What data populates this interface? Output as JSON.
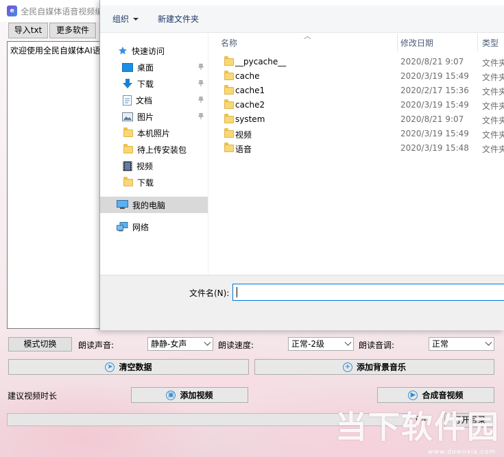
{
  "app": {
    "title": "全民自媒体语音视频编",
    "buttons": {
      "import_txt": "导入txt",
      "more_software": "更多软件"
    },
    "textarea_text": "欢迎使用全民自媒体AI语",
    "mode_switch": "模式切换",
    "voice_label": "朗读声音:",
    "voice_value": "静静-女声",
    "speed_label": "朗读速度:",
    "speed_value": "正常-2级",
    "pitch_label": "朗读音调:",
    "pitch_value": "正常",
    "clear_data": "清空数据",
    "add_bgm": "添加背景音乐",
    "suggest_duration_label": "建议视频时长",
    "add_video": "添加视频",
    "synthesize": "合成音视频",
    "progress_fraction": 0,
    "progress_text": "0%",
    "open_dir": "打开目录",
    "watermark": "当下软件园",
    "watermark_sub": "www.downxia.com"
  },
  "dialog": {
    "toolbar": {
      "organize": "组织",
      "new_folder": "新建文件夹"
    },
    "nav": {
      "quick_access": "快速访问",
      "desktop": "桌面",
      "downloads": "下载",
      "documents": "文档",
      "pictures": "图片",
      "local_photos": "本机照片",
      "pending_packages": "待上传安装包",
      "videos": "视频",
      "downloads2": "下载",
      "this_pc": "我的电脑",
      "network": "网络"
    },
    "columns": {
      "name": "名称",
      "date": "修改日期",
      "type": "类型"
    },
    "files": [
      {
        "name": "__pycache__",
        "date": "2020/8/21 9:07",
        "type": "文件夹"
      },
      {
        "name": "cache",
        "date": "2020/3/19 15:49",
        "type": "文件夹"
      },
      {
        "name": "cache1",
        "date": "2020/2/17 15:36",
        "type": "文件夹"
      },
      {
        "name": "cache2",
        "date": "2020/3/19 15:49",
        "type": "文件夹"
      },
      {
        "name": "system",
        "date": "2020/8/21 9:07",
        "type": "文件夹"
      },
      {
        "name": "视频",
        "date": "2020/3/19 15:49",
        "type": "文件夹"
      },
      {
        "name": "语音",
        "date": "2020/3/19 15:48",
        "type": "文件夹"
      }
    ],
    "filename_label": "文件名(N):",
    "filename_value": ""
  }
}
